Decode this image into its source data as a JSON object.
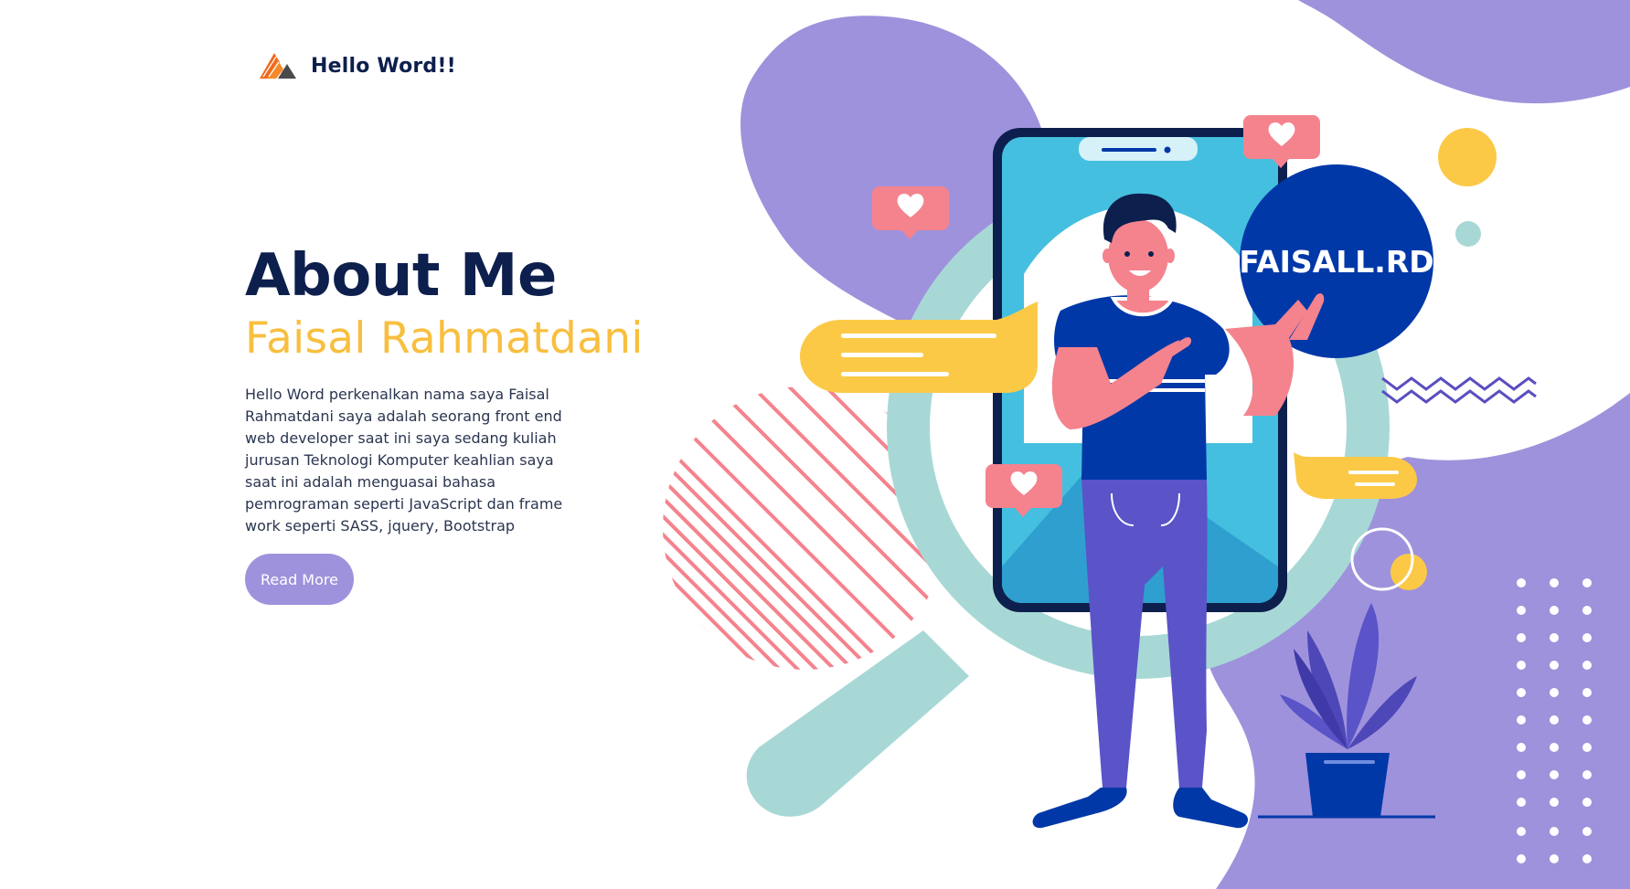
{
  "brand": {
    "name": "Hello Word!!",
    "logo_icon": "mountain-logo-icon"
  },
  "hero": {
    "title": "About Me",
    "subtitle": "Faisal Rahmatdani",
    "description": "Hello Word perkenalkan nama saya Faisal Rahmatdani saya adalah seorang front end web developer saat ini saya sedang kuliah jurusan Teknologi Komputer keahlian saya saat ini adalah menguasai bahasa pemrograman seperti JavaScript dan frame work seperti SASS, jquery, Bootstrap",
    "button_label": "Read More"
  },
  "illustration": {
    "badge_text": "FAISALL.RD",
    "icons": [
      "heart-icon",
      "chat-bubble-icon",
      "magnifier-icon",
      "smartphone-icon",
      "plant-icon",
      "zigzag-icon",
      "dot-grid-icon"
    ]
  },
  "colors": {
    "navy": "#0d1f4d",
    "accent_yellow": "#f8bf3f",
    "purple": "#9e92dc",
    "royal_blue": "#0038a8",
    "teal": "#a8d8d6",
    "pink": "#f4838e",
    "sky_blue": "#45bfdf"
  }
}
